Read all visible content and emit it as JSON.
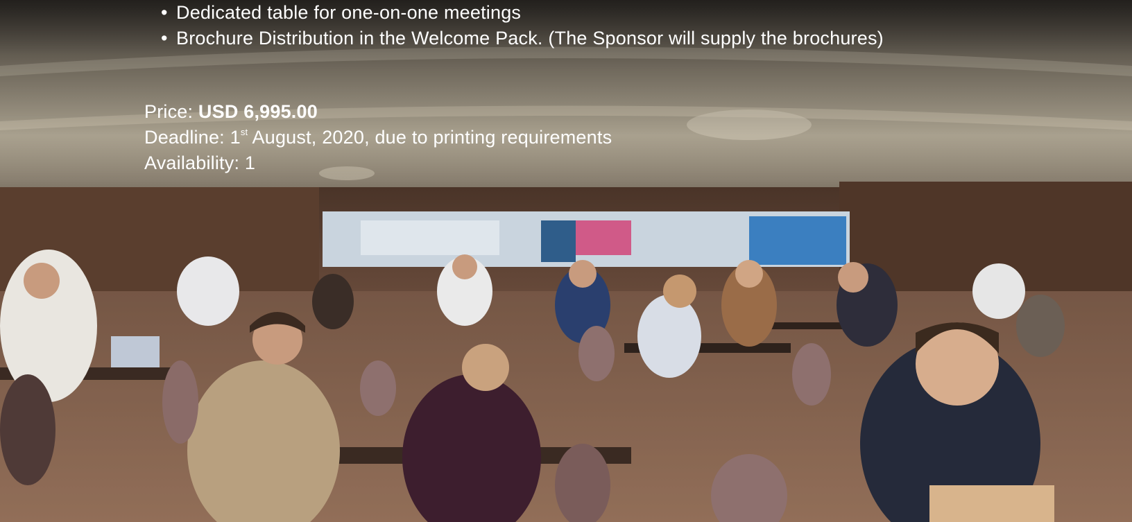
{
  "bullets": [
    "Dedicated table for one-on-one meetings",
    "Brochure Distribution in the Welcome Pack. (The Sponsor will supply the brochures)"
  ],
  "price": {
    "label": "Price: ",
    "value": "USD 6,995.00"
  },
  "deadline": {
    "label": "Deadline: ",
    "day": "1",
    "suffix": "st",
    "rest": " August, 2020, due to printing requirements"
  },
  "availability": "Availability: 1",
  "colors": {
    "text": "#ffffff",
    "ceiling": "#b9b09c",
    "carpet": "#8d6a55"
  }
}
